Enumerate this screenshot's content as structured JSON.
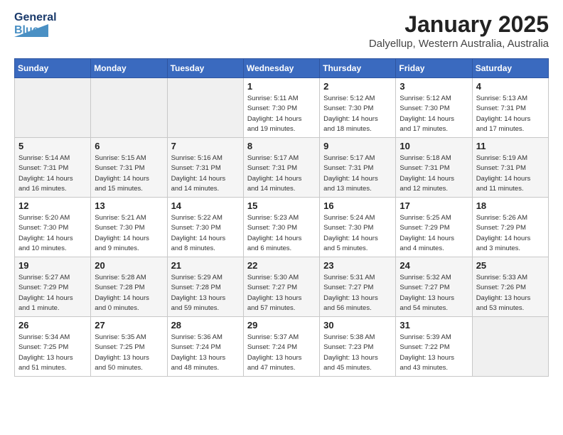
{
  "logo": {
    "line1": "General",
    "line2": "Blue"
  },
  "title": "January 2025",
  "location": "Dalyellup, Western Australia, Australia",
  "days_of_week": [
    "Sunday",
    "Monday",
    "Tuesday",
    "Wednesday",
    "Thursday",
    "Friday",
    "Saturday"
  ],
  "weeks": [
    [
      {
        "day": "",
        "info": ""
      },
      {
        "day": "",
        "info": ""
      },
      {
        "day": "",
        "info": ""
      },
      {
        "day": "1",
        "info": "Sunrise: 5:11 AM\nSunset: 7:30 PM\nDaylight: 14 hours\nand 19 minutes."
      },
      {
        "day": "2",
        "info": "Sunrise: 5:12 AM\nSunset: 7:30 PM\nDaylight: 14 hours\nand 18 minutes."
      },
      {
        "day": "3",
        "info": "Sunrise: 5:12 AM\nSunset: 7:30 PM\nDaylight: 14 hours\nand 17 minutes."
      },
      {
        "day": "4",
        "info": "Sunrise: 5:13 AM\nSunset: 7:31 PM\nDaylight: 14 hours\nand 17 minutes."
      }
    ],
    [
      {
        "day": "5",
        "info": "Sunrise: 5:14 AM\nSunset: 7:31 PM\nDaylight: 14 hours\nand 16 minutes."
      },
      {
        "day": "6",
        "info": "Sunrise: 5:15 AM\nSunset: 7:31 PM\nDaylight: 14 hours\nand 15 minutes."
      },
      {
        "day": "7",
        "info": "Sunrise: 5:16 AM\nSunset: 7:31 PM\nDaylight: 14 hours\nand 14 minutes."
      },
      {
        "day": "8",
        "info": "Sunrise: 5:17 AM\nSunset: 7:31 PM\nDaylight: 14 hours\nand 14 minutes."
      },
      {
        "day": "9",
        "info": "Sunrise: 5:17 AM\nSunset: 7:31 PM\nDaylight: 14 hours\nand 13 minutes."
      },
      {
        "day": "10",
        "info": "Sunrise: 5:18 AM\nSunset: 7:31 PM\nDaylight: 14 hours\nand 12 minutes."
      },
      {
        "day": "11",
        "info": "Sunrise: 5:19 AM\nSunset: 7:31 PM\nDaylight: 14 hours\nand 11 minutes."
      }
    ],
    [
      {
        "day": "12",
        "info": "Sunrise: 5:20 AM\nSunset: 7:30 PM\nDaylight: 14 hours\nand 10 minutes."
      },
      {
        "day": "13",
        "info": "Sunrise: 5:21 AM\nSunset: 7:30 PM\nDaylight: 14 hours\nand 9 minutes."
      },
      {
        "day": "14",
        "info": "Sunrise: 5:22 AM\nSunset: 7:30 PM\nDaylight: 14 hours\nand 8 minutes."
      },
      {
        "day": "15",
        "info": "Sunrise: 5:23 AM\nSunset: 7:30 PM\nDaylight: 14 hours\nand 6 minutes."
      },
      {
        "day": "16",
        "info": "Sunrise: 5:24 AM\nSunset: 7:30 PM\nDaylight: 14 hours\nand 5 minutes."
      },
      {
        "day": "17",
        "info": "Sunrise: 5:25 AM\nSunset: 7:29 PM\nDaylight: 14 hours\nand 4 minutes."
      },
      {
        "day": "18",
        "info": "Sunrise: 5:26 AM\nSunset: 7:29 PM\nDaylight: 14 hours\nand 3 minutes."
      }
    ],
    [
      {
        "day": "19",
        "info": "Sunrise: 5:27 AM\nSunset: 7:29 PM\nDaylight: 14 hours\nand 1 minute."
      },
      {
        "day": "20",
        "info": "Sunrise: 5:28 AM\nSunset: 7:28 PM\nDaylight: 14 hours\nand 0 minutes."
      },
      {
        "day": "21",
        "info": "Sunrise: 5:29 AM\nSunset: 7:28 PM\nDaylight: 13 hours\nand 59 minutes."
      },
      {
        "day": "22",
        "info": "Sunrise: 5:30 AM\nSunset: 7:27 PM\nDaylight: 13 hours\nand 57 minutes."
      },
      {
        "day": "23",
        "info": "Sunrise: 5:31 AM\nSunset: 7:27 PM\nDaylight: 13 hours\nand 56 minutes."
      },
      {
        "day": "24",
        "info": "Sunrise: 5:32 AM\nSunset: 7:27 PM\nDaylight: 13 hours\nand 54 minutes."
      },
      {
        "day": "25",
        "info": "Sunrise: 5:33 AM\nSunset: 7:26 PM\nDaylight: 13 hours\nand 53 minutes."
      }
    ],
    [
      {
        "day": "26",
        "info": "Sunrise: 5:34 AM\nSunset: 7:25 PM\nDaylight: 13 hours\nand 51 minutes."
      },
      {
        "day": "27",
        "info": "Sunrise: 5:35 AM\nSunset: 7:25 PM\nDaylight: 13 hours\nand 50 minutes."
      },
      {
        "day": "28",
        "info": "Sunrise: 5:36 AM\nSunset: 7:24 PM\nDaylight: 13 hours\nand 48 minutes."
      },
      {
        "day": "29",
        "info": "Sunrise: 5:37 AM\nSunset: 7:24 PM\nDaylight: 13 hours\nand 47 minutes."
      },
      {
        "day": "30",
        "info": "Sunrise: 5:38 AM\nSunset: 7:23 PM\nDaylight: 13 hours\nand 45 minutes."
      },
      {
        "day": "31",
        "info": "Sunrise: 5:39 AM\nSunset: 7:22 PM\nDaylight: 13 hours\nand 43 minutes."
      },
      {
        "day": "",
        "info": ""
      }
    ]
  ]
}
